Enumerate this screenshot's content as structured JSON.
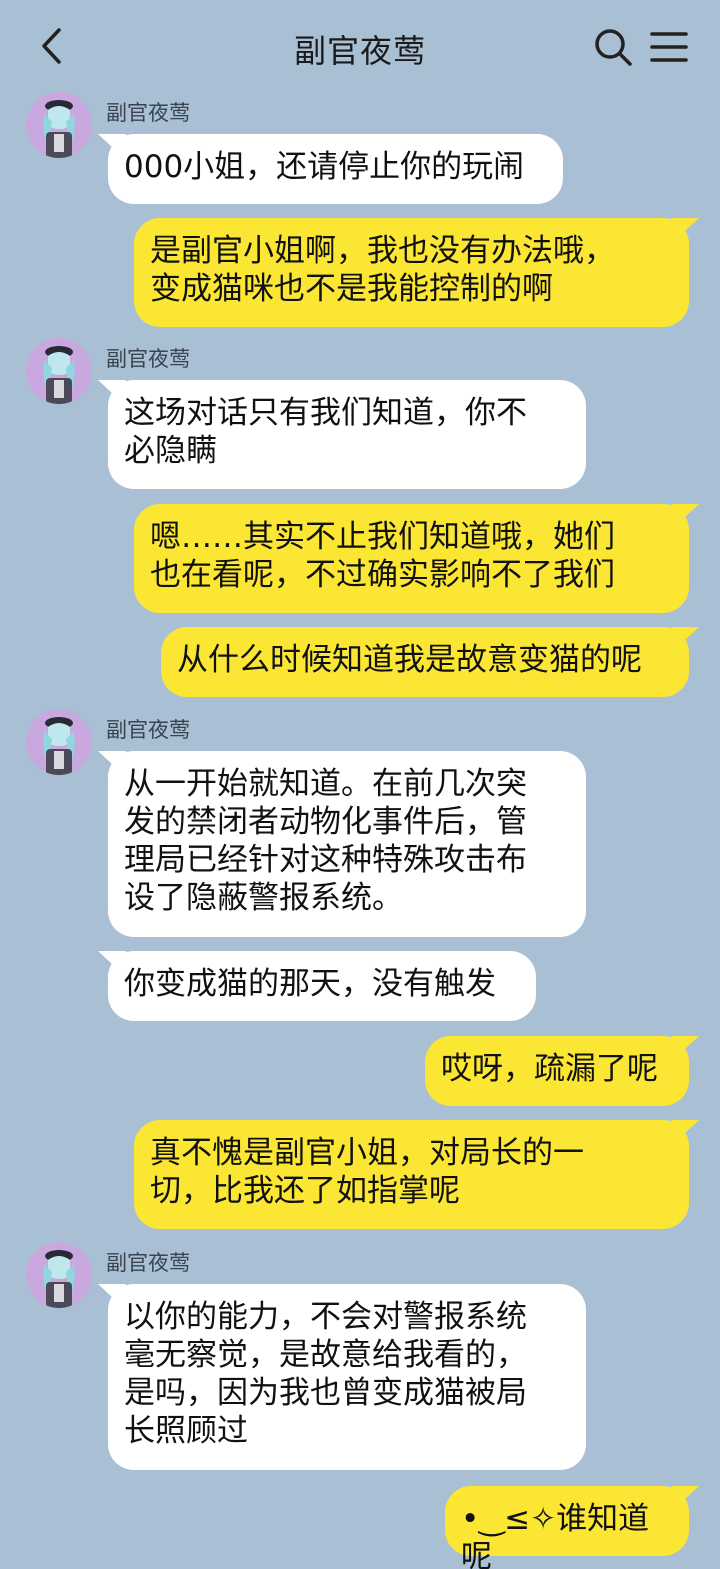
{
  "header": {
    "title": "副官夜莺",
    "back_icon": "chevron-left-icon",
    "search_icon": "search-icon",
    "menu_icon": "hamburger-menu-icon"
  },
  "colors": {
    "background": "#a9bfd3",
    "incoming_bubble": "#ffffff",
    "outgoing_bubble": "#fbe634"
  },
  "messages": [
    {
      "sender": "副官夜莺",
      "text": "000小姐，还请停止你的玩闹"
    },
    {
      "sender": "me",
      "text": "是副官小姐啊，我也没有办法哦，\n变成猫咪也不是我能控制的啊"
    },
    {
      "sender": "副官夜莺",
      "text": "这场对话只有我们知道，你不\n必隐瞒"
    },
    {
      "sender": "me",
      "text": "嗯……其实不止我们知道哦，她们\n也在看呢，不过确实影响不了我们"
    },
    {
      "sender": "me",
      "text": "从什么时候知道我是故意变猫的呢"
    },
    {
      "sender": "副官夜莺",
      "text": "从一开始就知道。在前几次突\n发的禁闭者动物化事件后，管\n理局已经针对这种特殊攻击布\n设了隐蔽警报系统。"
    },
    {
      "sender": "副官夜莺",
      "text": "你变成猫的那天，没有触发"
    },
    {
      "sender": "me",
      "text": "哎呀，疏漏了呢"
    },
    {
      "sender": "me",
      "text": "真不愧是副官小姐，对局长的一\n切，比我还了如指掌呢"
    },
    {
      "sender": "副官夜莺",
      "text": "以你的能力，不会对警报系统\n毫无察觉，是故意给我看的，\n是吗，因为我也曾变成猫被局\n长照顾过"
    },
    {
      "sender": "me",
      "text": "•‿≤✧谁知道呢"
    }
  ]
}
